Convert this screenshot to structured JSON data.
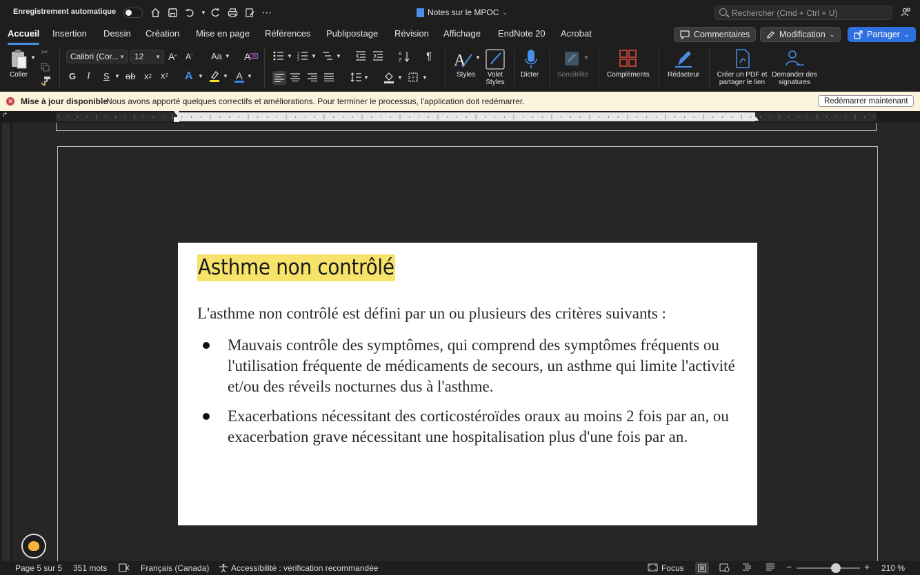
{
  "titlebar": {
    "autosave_label": "Enregistrement automatique",
    "doc_title": "Notes sur le MPOC",
    "search_placeholder": "Rechercher (Cmd + Ctrl + U)"
  },
  "tabs": [
    {
      "label": "Accueil",
      "active": true
    },
    {
      "label": "Insertion"
    },
    {
      "label": "Dessin"
    },
    {
      "label": "Création"
    },
    {
      "label": "Mise en page"
    },
    {
      "label": "Références"
    },
    {
      "label": "Publipostage"
    },
    {
      "label": "Révision"
    },
    {
      "label": "Affichage"
    },
    {
      "label": "EndNote 20"
    },
    {
      "label": "Acrobat"
    }
  ],
  "ribbon_buttons": {
    "comments": "Commentaires",
    "editing": "Modification",
    "share": "Partager"
  },
  "toolbar": {
    "paste": "Coller",
    "font_name": "Calibri (Cor...",
    "font_size": "12",
    "bold": "G",
    "italic": "I",
    "underline": "S",
    "strike": "ab",
    "change_case": "Aa",
    "styles": "Styles",
    "styles_pane_1": "Volet",
    "styles_pane_2": "Styles",
    "dictate": "Dicter",
    "sensitivity": "Sensibilité",
    "addins": "Compléments",
    "editor": "Rédacteur",
    "pdf_1": "Créer un PDF et",
    "pdf_2": "partager le lien",
    "sign_1": "Demander des",
    "sign_2": "signatures"
  },
  "notification": {
    "title": "Mise à jour disponible",
    "message": "Nous avons apporté quelques correctifs et améliorations. Pour terminer le processus, l'application doit  redémarrer.",
    "button": "Redémarrer maintenant"
  },
  "document": {
    "heading": "Asthme non contrôlé",
    "intro": "L'asthme non contrôlé est défini par un ou plusieurs des critères suivants :",
    "bullets": [
      "Mauvais contrôle des symptômes, qui comprend des symptômes fréquents ou l'utilisation fréquente de médicaments de secours, un asthme qui limite l'activité et/ou des réveils nocturnes dus à l'asthme.",
      "Exacerbations nécessitant des corticostéroïdes oraux au moins 2 fois par an, ou exacerbation grave nécessitant une hospitalisation plus d'une fois par an."
    ]
  },
  "statusbar": {
    "page": "Page 5 sur 5",
    "words": "351 mots",
    "language": "Français (Canada)",
    "accessibility": "Accessibilité : vérification recommandée",
    "focus": "Focus",
    "zoom": "210 %"
  },
  "colors": {
    "accent": "#2f6fe0",
    "highlight": "#f7e36a",
    "notification_bg": "#fbf3dc"
  }
}
